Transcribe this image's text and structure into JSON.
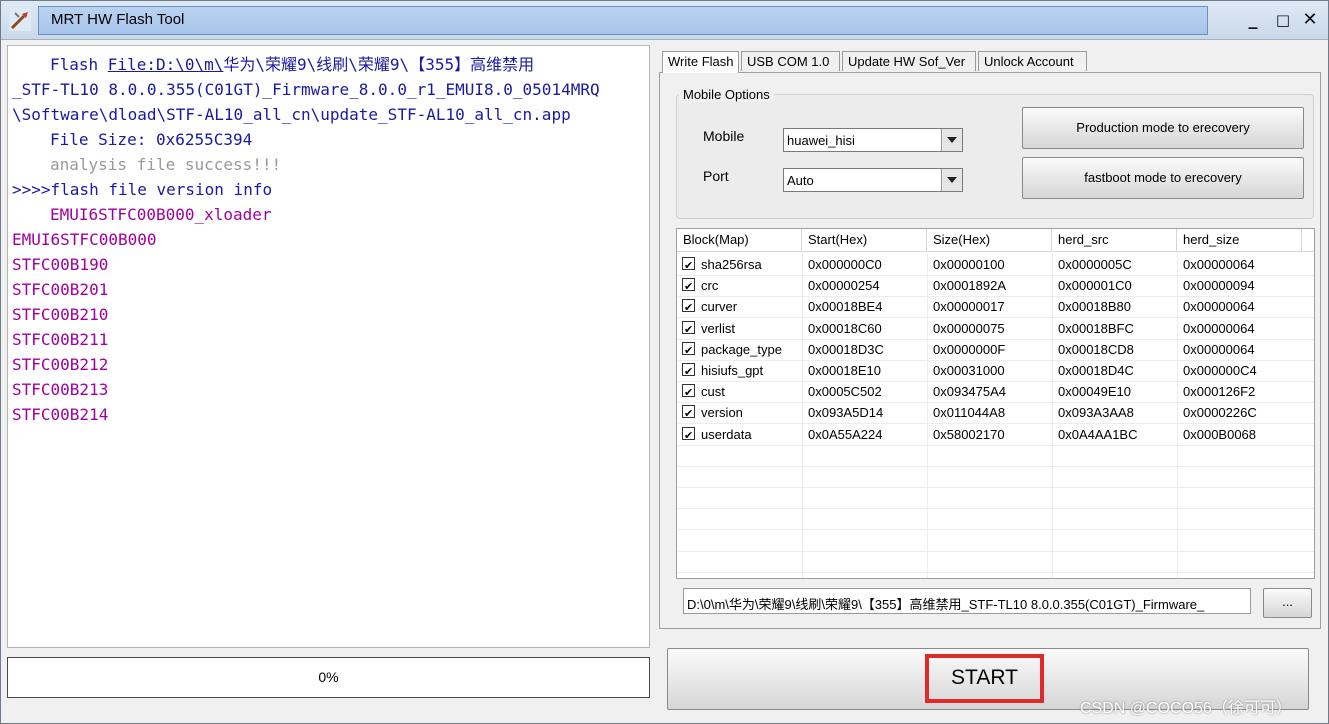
{
  "window": {
    "title": "MRT HW Flash Tool",
    "minimize": "_",
    "maximize": "□",
    "close": "✕"
  },
  "log": {
    "l1_prefix": "Flash ",
    "l1_link": "File:D:\\0\\m\\",
    "l1_rest": "华为\\荣耀9\\线刷\\荣耀9\\【355】高维禁用",
    "l2": "_STF-TL10 8.0.0.355(C01GT)_Firmware_8.0.0_r1_EMUI8.0_05014MRQ",
    "l3": "\\Software\\dload\\STF-AL10_all_cn\\update_STF-AL10_all_cn.app",
    "l4": "File Size: 0x6255C394",
    "l5": "analysis file success!!!",
    "l6": ">>>>flash file version info",
    "l7": "EMUI6STFC00B000_xloader",
    "versions": [
      "EMUI6STFC00B000",
      "STFC00B190",
      "STFC00B201",
      "STFC00B210",
      "STFC00B211",
      "STFC00B212",
      "STFC00B213",
      "STFC00B214"
    ]
  },
  "progress": {
    "text": "0%",
    "value": 0
  },
  "tabs": [
    "Write Flash",
    "USB COM 1.0",
    "Update HW Sof_Ver",
    "Unlock Account"
  ],
  "mobile_options": {
    "title": "Mobile Options",
    "mobile_label": "Mobile",
    "mobile_value": "huawei_hisi",
    "port_label": "Port",
    "port_value": "Auto",
    "btn_production": "Production mode to erecovery",
    "btn_fastboot": "fastboot mode to erecovery"
  },
  "table": {
    "headers": [
      "Block(Map)",
      "Start(Hex)",
      "Size(Hex)",
      "herd_src",
      "herd_size"
    ],
    "rows": [
      [
        "sha256rsa",
        "0x000000C0",
        "0x00000100",
        "0x0000005C",
        "0x00000064"
      ],
      [
        "crc",
        "0x00000254",
        "0x0001892A",
        "0x000001C0",
        "0x00000094"
      ],
      [
        "curver",
        "0x00018BE4",
        "0x00000017",
        "0x00018B80",
        "0x00000064"
      ],
      [
        "verlist",
        "0x00018C60",
        "0x00000075",
        "0x00018BFC",
        "0x00000064"
      ],
      [
        "package_type",
        "0x00018D3C",
        "0x0000000F",
        "0x00018CD8",
        "0x00000064"
      ],
      [
        "hisiufs_gpt",
        "0x00018E10",
        "0x00031000",
        "0x00018D4C",
        "0x000000C4"
      ],
      [
        "cust",
        "0x0005C502",
        "0x093475A4",
        "0x00049E10",
        "0x000126F2"
      ],
      [
        "version",
        "0x093A5D14",
        "0x011044A8",
        "0x093A3AA8",
        "0x0000226C"
      ],
      [
        "userdata",
        "0x0A55A224",
        "0x58002170",
        "0x0A4AA1BC",
        "0x000B0068"
      ]
    ]
  },
  "file_path": "D:\\0\\m\\华为\\荣耀9\\线刷\\荣耀9\\【355】高维禁用_STF-TL10 8.0.0.355(C01GT)_Firmware_",
  "browse_label": "...",
  "start_label": "START",
  "watermark": "CSDN @COCO56（徐可可）"
}
